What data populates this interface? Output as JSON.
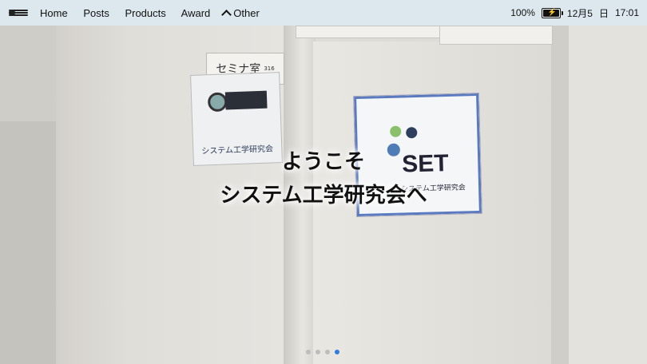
{
  "topbar": {
    "nav": [
      "Home",
      "Posts",
      "Products",
      "Award"
    ],
    "other_label": "Other"
  },
  "status": {
    "battery": "100%",
    "date": "12月5",
    "day": "日",
    "time": "17:01"
  },
  "scene": {
    "seminar_room": "セミナ室",
    "room_number": "316",
    "sign_left_caption": "システム工学研究会",
    "sign_right_brand": "SET",
    "sign_right_caption": "システム工学研究会"
  },
  "hero": {
    "line1": "ようこそ",
    "line2": "システム工学研究会へ"
  },
  "carousel": {
    "count": 4,
    "active_index": 3
  },
  "colors": {
    "topbar": "#dce8ee",
    "active_dot": "#2f7de0"
  }
}
